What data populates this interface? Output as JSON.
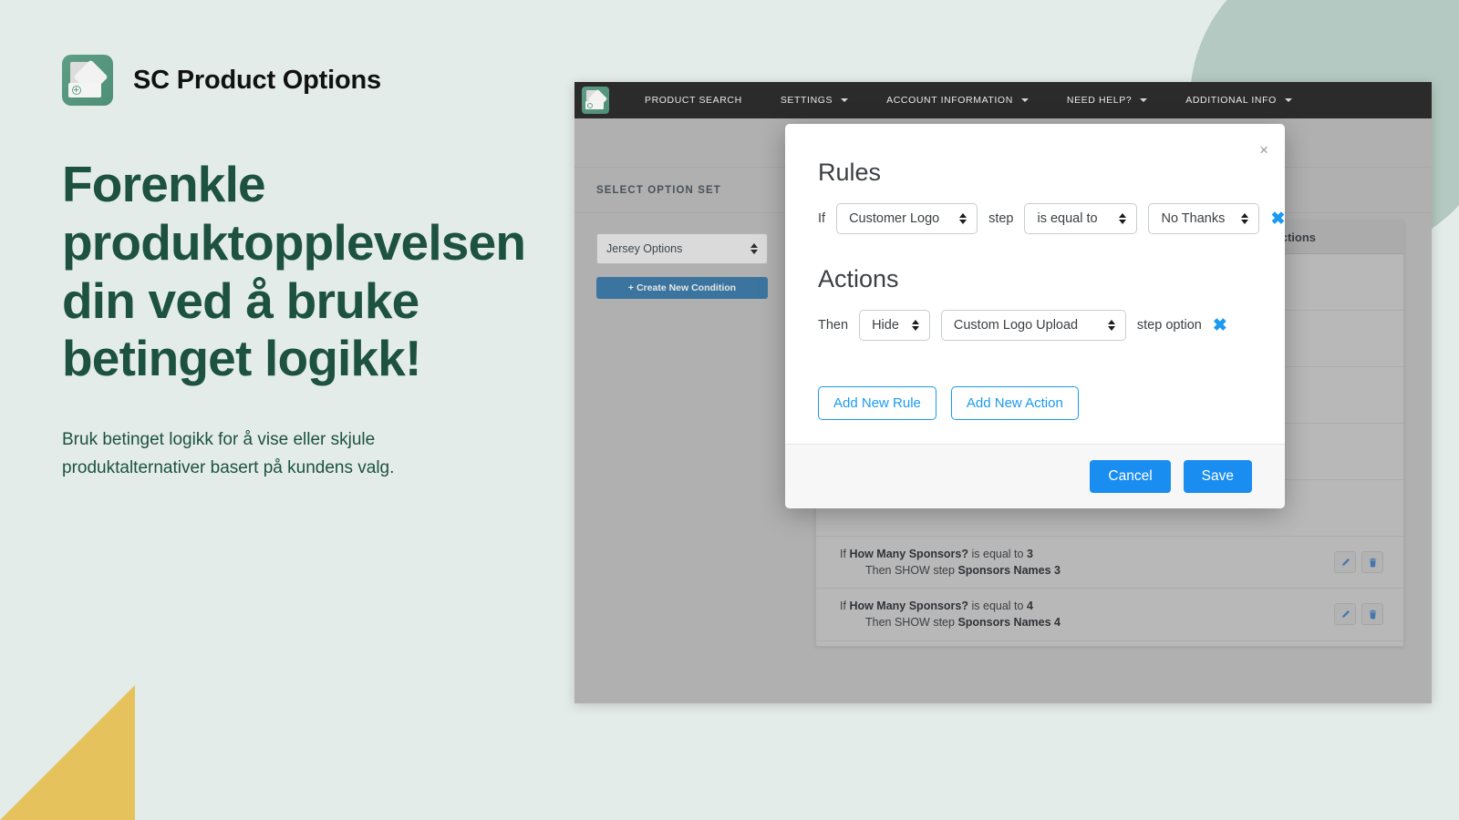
{
  "brand": {
    "name": "SC Product Options",
    "logo_icon": "product-options-logo-icon"
  },
  "marketing": {
    "headline": "Forenkle produktopplevelsen din ved å bruke betinget logikk!",
    "subcopy": "Bruk betinget logikk for å vise eller skjule produktalternativer basert på kundens valg."
  },
  "app": {
    "nav": {
      "logo_icon": "app-logo-icon",
      "items": [
        {
          "label": "PRODUCT SEARCH",
          "has_caret": false
        },
        {
          "label": "SETTINGS",
          "has_caret": true
        },
        {
          "label": "ACCOUNT INFORMATION",
          "has_caret": true
        },
        {
          "label": "NEED HELP?",
          "has_caret": true
        },
        {
          "label": "ADDITIONAL INFO",
          "has_caret": true
        }
      ]
    },
    "left_pane": {
      "section_label": "SELECT OPTION SET",
      "option_set_value": "Jersey Options",
      "create_button": "+ Create New Condition"
    },
    "conditions_table": {
      "actions_column_header": "Actions",
      "rows": [
        {
          "line1_prefix": "If",
          "line1_bold": "How Many Sponsors?",
          "line1_mid": "is equal to",
          "line1_value": "3",
          "line2": "Then SHOW step",
          "line2_bold": "Sponsors Names 3"
        },
        {
          "line1_prefix": "If",
          "line1_bold": "How Many Sponsors?",
          "line1_mid": "is equal to",
          "line1_value": "4",
          "line2": "Then SHOW step",
          "line2_bold": "Sponsors Names 4"
        }
      ],
      "edit_icon": "pencil-icon",
      "delete_icon": "trash-icon"
    }
  },
  "modal": {
    "close_label": "×",
    "rules": {
      "title": "Rules",
      "if_label": "If",
      "field_value": "Customer Logo",
      "step_label": "step",
      "operator_value": "is equal to",
      "compare_value": "No Thanks",
      "remove_icon_label": "✖"
    },
    "actions": {
      "title": "Actions",
      "then_label": "Then",
      "action_value": "Hide",
      "target_value": "Custom Logo Upload",
      "suffix_label": "step option",
      "remove_icon_label": "✖"
    },
    "add_rule_label": "Add New Rule",
    "add_action_label": "Add New Action",
    "cancel_label": "Cancel",
    "save_label": "Save"
  },
  "colors": {
    "page_background": "#e4ecea",
    "brand_green": "#1d5240",
    "accent_blue": "#1a8df0",
    "decor_circle": "#b4c9c1",
    "decor_triangle": "#e6c25c",
    "nav_dark": "#2b2b2b",
    "create_button_blue": "#2e75a8"
  }
}
